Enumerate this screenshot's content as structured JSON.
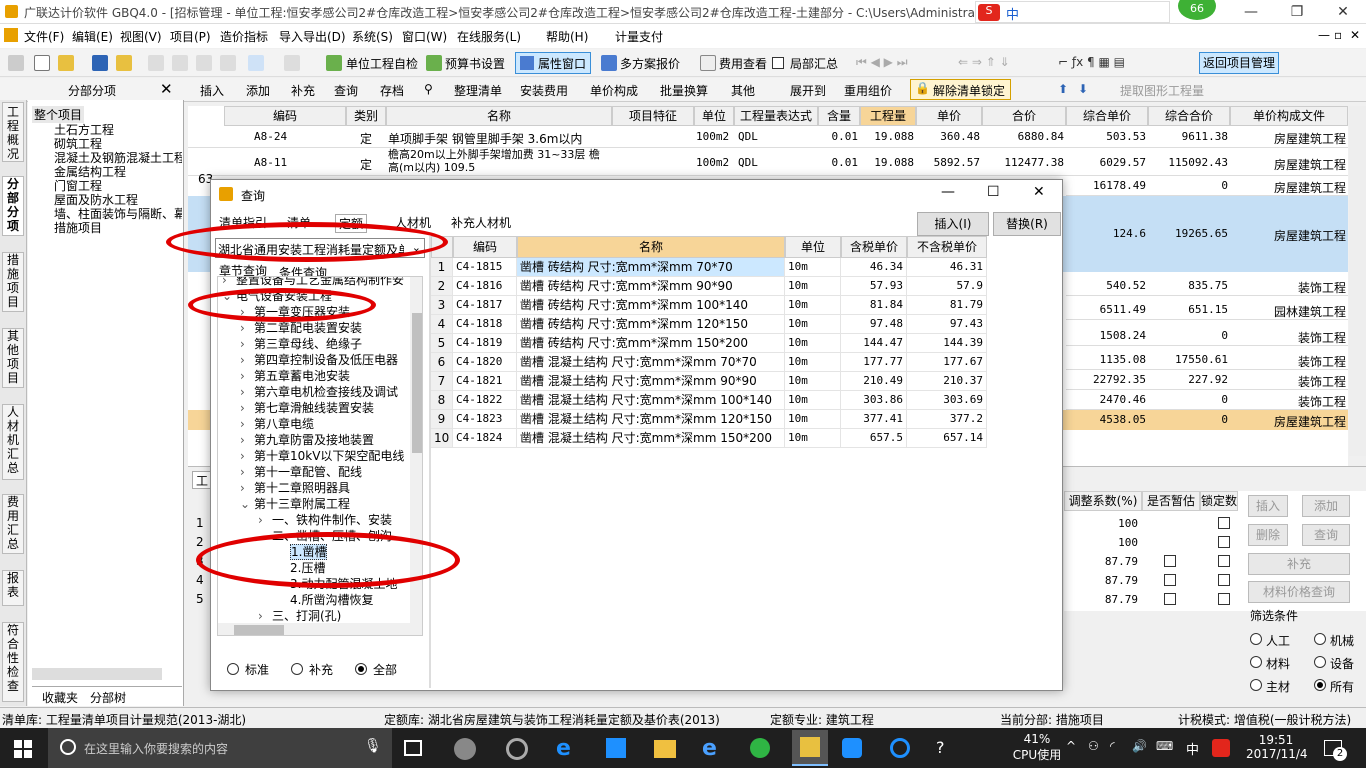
{
  "window": {
    "title": "广联达计价软件 GBQ4.0 - [招标管理 - 单位工程:恒安孝感公司2#仓库改造工程>恒安孝感公司2#仓库改造工程>恒安孝感公司2#仓库改造工程-土建部分 - C:\\Users\\Administrato"
  },
  "menu": [
    "文件(F)",
    "编辑(E)",
    "视图(V)",
    "项目(P)",
    "造价指标",
    "导入导出(D)",
    "系统(S)",
    "窗口(W)",
    "在线服务(L)",
    "帮助(H)",
    "计量支付"
  ],
  "toolbar1": {
    "self_check": "单位工程自检",
    "budget_settings": "预算书设置",
    "property_window": "属性窗口",
    "multi_plan": "多方案报价",
    "fee_view": "费用查看",
    "local_summary": "局部汇总",
    "return_project": "返回项目管理"
  },
  "toolbar2": {
    "panel_title": "分部分项",
    "items": [
      "插入",
      "添加",
      "补充",
      "查询",
      "存档",
      "整理清单",
      "安装费用",
      "单价构成",
      "批量换算",
      "其他",
      "展开到",
      "重用组价",
      "解除清单锁定",
      "提取图形工程量"
    ]
  },
  "vtabs": [
    "工程概况",
    "分部分项",
    "措施项目",
    "其他项目",
    "人材机汇总",
    "费用汇总",
    "报表",
    "符合性检查"
  ],
  "left_tree": {
    "root": "整个项目",
    "items": [
      "土石方工程",
      "砌筑工程",
      "混凝土及钢筋混凝土工程",
      "金属结构工程",
      "门窗工程",
      "屋面及防水工程",
      "墙、柱面装饰与隔断、幕",
      "措施项目"
    ],
    "bottom_tabs": [
      "收藏夹",
      "分部树"
    ]
  },
  "grid": {
    "headers": [
      "编码",
      "类别",
      "名称",
      "项目特征",
      "单位",
      "工程量表达式",
      "含量",
      "工程量",
      "单价",
      "合价",
      "综合单价",
      "综合合价",
      "单价构成文件"
    ],
    "rows": [
      {
        "code": "A8-24",
        "type": "定",
        "name": "单项脚手架 钢管里脚手架 3.6m以内",
        "unit": "100m2",
        "expr": "QDL",
        "qty_ratio": "0.01",
        "qty": "19.088",
        "price": "360.48",
        "total": "6880.84",
        "unit_total": "503.53",
        "sum_total": "9611.38",
        "file": "房屋建筑工程"
      },
      {
        "code": "A8-11",
        "type": "定",
        "name": "檐高20m以上外脚手架增加费 31~33层 檐高(m以内) 109.5",
        "unit": "100m2",
        "expr": "QDL",
        "qty_ratio": "0.01",
        "qty": "19.088",
        "price": "5892.57",
        "total": "112477.38",
        "unit_total": "6029.57",
        "sum_total": "115092.43",
        "file": "房屋建筑工程"
      }
    ],
    "right_rows": [
      {
        "a": "16178.49",
        "b": "0",
        "c": "房屋建筑工程"
      },
      {
        "a": "124.6",
        "b": "19265.65",
        "c": "房屋建筑工程"
      },
      {
        "a": "540.52",
        "b": "835.75",
        "c": "装饰工程"
      },
      {
        "a": "6511.49",
        "b": "651.15",
        "c": "园林建筑工程"
      },
      {
        "a": "1508.24",
        "b": "0",
        "c": "装饰工程"
      },
      {
        "a": "1135.08",
        "b": "17550.61",
        "c": "装饰工程"
      },
      {
        "a": "22792.35",
        "b": "227.92",
        "c": "装饰工程"
      },
      {
        "a": "2470.46",
        "b": "0",
        "c": "装饰工程"
      },
      {
        "a": "4538.05",
        "b": "0",
        "c": "房屋建筑工程"
      }
    ],
    "row_num": "63"
  },
  "bottom": {
    "headers": [
      "调整系数(%)",
      "是否暂估",
      "锁定数"
    ],
    "row_nums": [
      "1",
      "2",
      "3",
      "4",
      "5"
    ],
    "coef": [
      "100",
      "100",
      "87.79",
      "87.79",
      "87.79"
    ],
    "buttons": [
      "插入",
      "添加",
      "删除",
      "查询",
      "补充",
      "材料价格查询"
    ],
    "filter_title": "筛选条件",
    "filters": [
      "人工",
      "机械",
      "材料",
      "设备",
      "主材",
      "所有"
    ],
    "left_tab": "工"
  },
  "dialog": {
    "title": "查询",
    "tabs": [
      "清单指引",
      "清单",
      "定额",
      "人材机",
      "补充人材机"
    ],
    "insert": "插入(I)",
    "replace": "替换(R)",
    "library": "湖北省通用安装工程消耗量定额及单",
    "subtabs": [
      "章节查询",
      "条件查询"
    ],
    "tree": [
      {
        "t": "整置设备与工艺金属结构制作安",
        "lvl": 0,
        "exp": "›"
      },
      {
        "t": "电气设备安装工程",
        "lvl": 0,
        "exp": "⌄"
      },
      {
        "t": "第一章变压器安装",
        "lvl": 1,
        "exp": "›"
      },
      {
        "t": "第二章配电装置安装",
        "lvl": 1,
        "exp": "›"
      },
      {
        "t": "第三章母线、绝缘子",
        "lvl": 1,
        "exp": "›"
      },
      {
        "t": "第四章控制设备及低压电器",
        "lvl": 1,
        "exp": "›"
      },
      {
        "t": "第五章蓄电池安装",
        "lvl": 1,
        "exp": "›"
      },
      {
        "t": "第六章电机检查接线及调试",
        "lvl": 1,
        "exp": "›"
      },
      {
        "t": "第七章滑触线装置安装",
        "lvl": 1,
        "exp": "›"
      },
      {
        "t": "第八章电缆",
        "lvl": 1,
        "exp": "›"
      },
      {
        "t": "第九章防雷及接地装置",
        "lvl": 1,
        "exp": "›"
      },
      {
        "t": "第十章10kV以下架空配电线",
        "lvl": 1,
        "exp": "›"
      },
      {
        "t": "第十一章配管、配线",
        "lvl": 1,
        "exp": "›"
      },
      {
        "t": "第十二章照明器具",
        "lvl": 1,
        "exp": "›"
      },
      {
        "t": "第十三章附属工程",
        "lvl": 1,
        "exp": "⌄"
      },
      {
        "t": "一、铁构件制作、安装",
        "lvl": 2,
        "exp": "›"
      },
      {
        "t": "二、凿槽、压槽、刨沟",
        "lvl": 2,
        "exp": "⌄"
      },
      {
        "t": "1.凿槽",
        "lvl": 3,
        "exp": ""
      },
      {
        "t": "2.压槽",
        "lvl": 3,
        "exp": ""
      },
      {
        "t": "3.动力配管混凝土地",
        "lvl": 3,
        "exp": ""
      },
      {
        "t": "4.所凿沟槽恢复",
        "lvl": 3,
        "exp": ""
      },
      {
        "t": "三、打洞(孔)",
        "lvl": 2,
        "exp": "›"
      }
    ],
    "radios": [
      "标准",
      "补充",
      "全部"
    ],
    "headers": [
      "编码",
      "名称",
      "单位",
      "含税单价",
      "不含税单价"
    ],
    "rows": [
      [
        "1",
        "C4-1815",
        "凿槽 砖结构 尺寸:宽mm*深mm 70*70",
        "10m",
        "46.34",
        "46.31"
      ],
      [
        "2",
        "C4-1816",
        "凿槽 砖结构 尺寸:宽mm*深mm 90*90",
        "10m",
        "57.93",
        "57.9"
      ],
      [
        "3",
        "C4-1817",
        "凿槽 砖结构 尺寸:宽mm*深mm 100*140",
        "10m",
        "81.84",
        "81.79"
      ],
      [
        "4",
        "C4-1818",
        "凿槽 砖结构 尺寸:宽mm*深mm 120*150",
        "10m",
        "97.48",
        "97.43"
      ],
      [
        "5",
        "C4-1819",
        "凿槽 砖结构 尺寸:宽mm*深mm 150*200",
        "10m",
        "144.47",
        "144.39"
      ],
      [
        "6",
        "C4-1820",
        "凿槽 混凝土结构 尺寸:宽mm*深mm 70*70",
        "10m",
        "177.77",
        "177.67"
      ],
      [
        "7",
        "C4-1821",
        "凿槽 混凝土结构 尺寸:宽mm*深mm 90*90",
        "10m",
        "210.49",
        "210.37"
      ],
      [
        "8",
        "C4-1822",
        "凿槽 混凝土结构 尺寸:宽mm*深mm 100*140",
        "10m",
        "303.86",
        "303.69"
      ],
      [
        "9",
        "C4-1823",
        "凿槽 混凝土结构 尺寸:宽mm*深mm 120*150",
        "10m",
        "377.41",
        "377.2"
      ],
      [
        "10",
        "C4-1824",
        "凿槽 混凝土结构 尺寸:宽mm*深mm 150*200",
        "10m",
        "657.5",
        "657.14"
      ]
    ]
  },
  "status": {
    "list_lib": "清单库: 工程量清单项目计量规范(2013-湖北)",
    "quota_lib": "定额库: 湖北省房屋建筑与装饰工程消耗量定额及基价表(2013)",
    "quota_major": "定额专业: 建筑工程",
    "current_part": "当前分部: 措施项目",
    "tax_mode": "计税模式: 增值税(一般计税方法)"
  },
  "taskbar": {
    "search": "在这里输入你要搜索的内容",
    "cpu": "41%",
    "cpu_label": "CPU使用",
    "ime": "中",
    "time": "19:51",
    "date": "2017/11/4",
    "notif": "2",
    "badge": "66"
  },
  "colors": {
    "accent": "#cce8ff",
    "highlight": "#f7d598",
    "annotation": "#e00000",
    "selected_row": "#c5dff5"
  }
}
